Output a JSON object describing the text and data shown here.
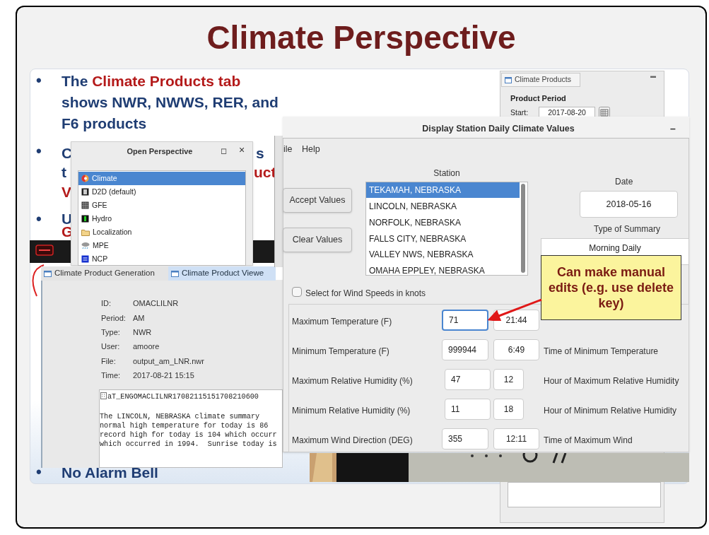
{
  "slide": {
    "title": "Climate Perspective"
  },
  "bullets": [
    {
      "kind": "full",
      "marker": "•",
      "segments": [
        {
          "text": "The ",
          "highlight": false
        },
        {
          "text": "Climate Products tab",
          "highlight": true
        },
        {
          "text": " shows NWR, NWWS, RER, and F6 products",
          "highlight": false
        }
      ]
    },
    {
      "kind": "partial",
      "marker": "•",
      "fragments": [
        {
          "text": "C",
          "highlight": false
        },
        {
          "text": "s",
          "highlight": false
        },
        {
          "text": "t",
          "highlight": false
        },
        {
          "text": "uct",
          "highlight": true
        },
        {
          "text": "V",
          "highlight": true
        }
      ]
    },
    {
      "kind": "partial",
      "marker": "•",
      "fragments": [
        {
          "text": "U",
          "highlight": false
        },
        {
          "text": "G",
          "highlight": true
        }
      ]
    },
    {
      "kind": "full",
      "marker": "•",
      "segments": [
        {
          "text": "No Alarm Bell",
          "highlight": false
        }
      ]
    }
  ],
  "products_panel": {
    "tab": "Climate Products",
    "minimize": "▬",
    "group_title": "Product Period",
    "start_label": "Start:",
    "start_value": "2017-08-20"
  },
  "open_perspective": {
    "title": "Open Perspective",
    "maximize": "◻",
    "close": "×",
    "items": [
      {
        "label": "Climate",
        "selected": true
      },
      {
        "label": "D2D (default)",
        "selected": false
      },
      {
        "label": "GFE",
        "selected": false
      },
      {
        "label": "Hydro",
        "selected": false
      },
      {
        "label": "Localization",
        "selected": false
      },
      {
        "label": "MPE",
        "selected": false
      },
      {
        "label": "NCP",
        "selected": false
      }
    ]
  },
  "viewer": {
    "tabs": [
      {
        "label": "Climate Product Generation",
        "selected": false
      },
      {
        "label": "Climate Product Viewe",
        "selected": true
      }
    ],
    "fields": [
      {
        "label": "ID:",
        "value": "OMACLILNR"
      },
      {
        "label": "Period:",
        "value": "AM"
      },
      {
        "label": "Type:",
        "value": "NWR"
      },
      {
        "label": "User:",
        "value": "amoore"
      },
      {
        "label": "File:",
        "value": "output_am_LNR.nwr"
      },
      {
        "label": "Time:",
        "value": "2017-08-21 15:15"
      }
    ],
    "header_line": "aT_ENGOMACLILNR17082115151708210600",
    "lines": [
      "The LINCOLN, NEBRASKA climate summary",
      "normal high temperature for today is 86",
      "record high for today is 104 which occurr",
      "which occurred in 1994.  Sunrise today is"
    ]
  },
  "dialog": {
    "title": "Display Station Daily Climate Values",
    "minimize": "–",
    "menu": [
      "ile",
      "Help"
    ],
    "buttons": [
      "Accept Values",
      "Clear Values"
    ],
    "station_label": "Station",
    "stations": [
      {
        "label": "TEKAMAH, NEBRASKA",
        "selected": true
      },
      {
        "label": "LINCOLN, NEBRASKA",
        "selected": false
      },
      {
        "label": "NORFOLK, NEBRASKA",
        "selected": false
      },
      {
        "label": "FALLS CITY, NEBRASKA",
        "selected": false
      },
      {
        "label": "VALLEY  NWS, NEBRASKA",
        "selected": false
      },
      {
        "label": "OMAHA EPPLEY, NEBRASKA",
        "selected": false
      }
    ],
    "date_label": "Date",
    "date": "2018-05-16",
    "summary_label": "Type of Summary",
    "summary": "Morning Daily",
    "wind_knots": {
      "label": "Select for Wind Speeds in knots",
      "checked": false
    },
    "rows": [
      {
        "kind": "time",
        "label": "Maximum Temperature (F)",
        "value": "71",
        "focused": true,
        "time": "21:44"
      },
      {
        "kind": "time",
        "label": "Minimum Temperature (F)",
        "value": "999944",
        "focused": false,
        "time": "6:49",
        "time_label": "Time of Minimum Temperature"
      },
      {
        "kind": "hour",
        "label": "Maximum Relative Humidity (%)",
        "value": "47",
        "focused": false,
        "time": "12",
        "time_label": "Hour of Maximum Relative Humidity"
      },
      {
        "kind": "hour",
        "label": "Minimum Relative Humidity (%)",
        "value": "11",
        "focused": false,
        "time": "18",
        "time_label": "Hour of Minimum Relative Humidity"
      },
      {
        "kind": "time",
        "label": "Maximum Wind Direction (DEG)",
        "value": "355",
        "focused": false,
        "time": "12:11",
        "time_label": "Time of Maximum Wind"
      }
    ]
  },
  "callout": {
    "text": "Can make manual edits (e.g. use delete key)"
  }
}
